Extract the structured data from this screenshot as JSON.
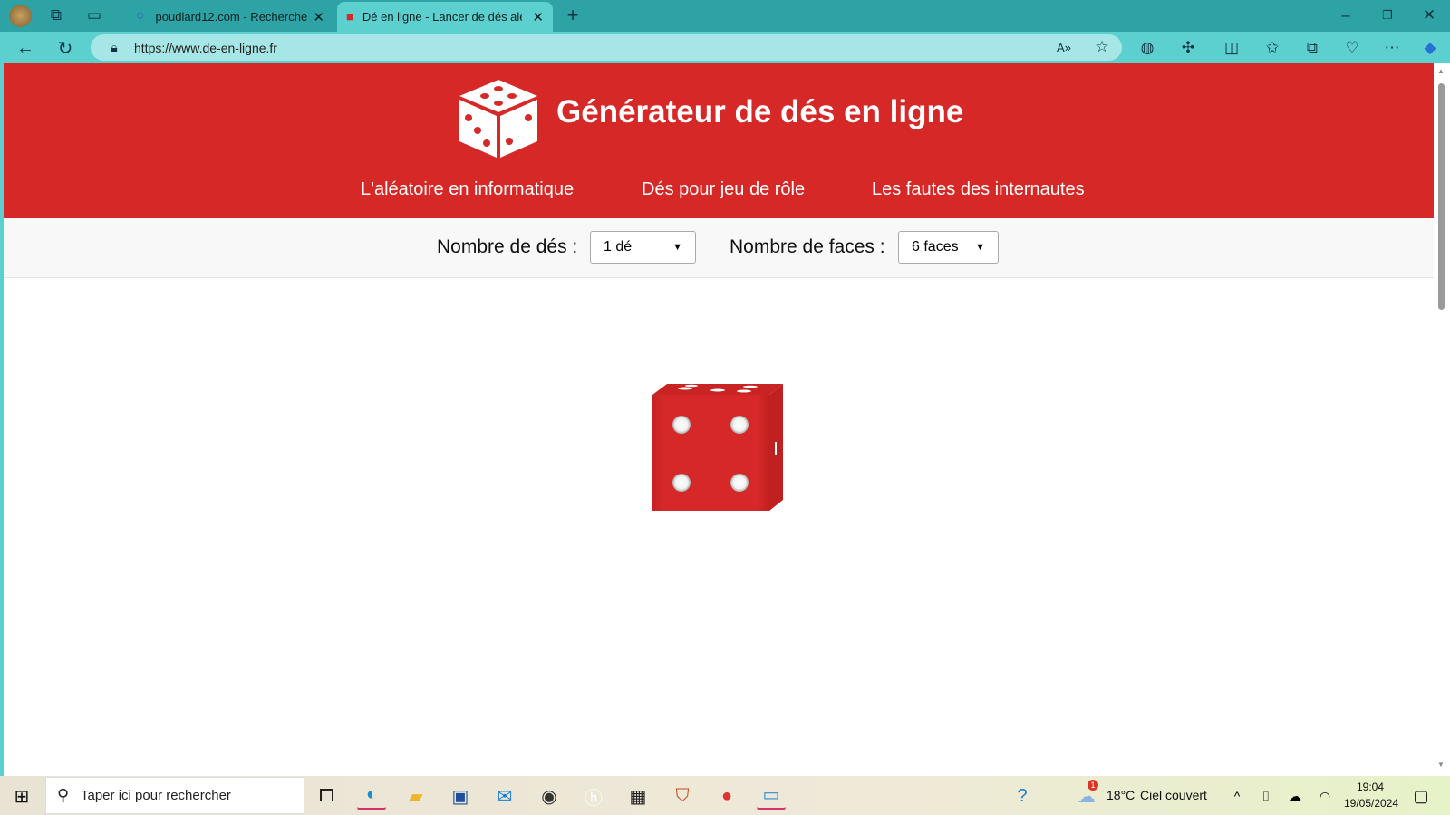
{
  "browser": {
    "tabs": [
      {
        "title": "poudlard12.com - Recherche",
        "active": false
      },
      {
        "title": "Dé en ligne - Lancer de dés aléat",
        "active": true
      }
    ],
    "url": "https://www.de-en-ligne.fr"
  },
  "site": {
    "title": "Générateur de dés en ligne",
    "nav": [
      "L'aléatoire en informatique",
      "Dés pour jeu de rôle",
      "Les fautes des internautes"
    ],
    "dice_count_label": "Nombre de dés :",
    "dice_count_value": "1 dé",
    "faces_label": "Nombre de faces :",
    "faces_value": "6 faces",
    "result_value": 4,
    "brand_color": "#d72828"
  },
  "taskbar": {
    "search_placeholder": "Taper ici pour rechercher",
    "weather_temp": "18°C",
    "weather_text": "Ciel couvert",
    "weather_badge": "1",
    "time": "19:04",
    "date": "19/05/2024"
  }
}
